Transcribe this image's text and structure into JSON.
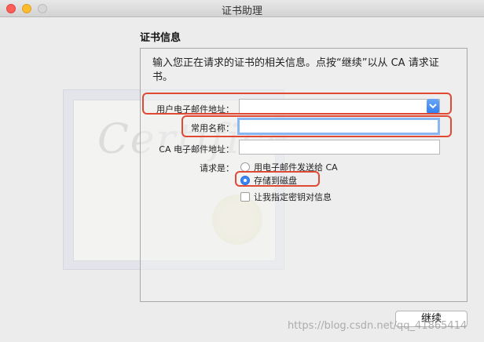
{
  "window": {
    "title": "证书助理"
  },
  "heading": "证书信息",
  "description": "输入您正在请求的证书的相关信息。点按“继续”以从 CA 请求证书。",
  "form": {
    "user_email_label": "用户电子邮件地址：",
    "user_email_value": "",
    "common_name_label": "常用名称：",
    "common_name_value": "",
    "ca_email_label": "CA 电子邮件地址：",
    "ca_email_value": "",
    "request_label": "请求是：",
    "option_email": "用电子邮件发送给 CA",
    "option_disk": "存储到磁盘",
    "option_disk_selected": true,
    "custom_key_label": "让我指定密钥对信息",
    "custom_key_checked": false
  },
  "continue_label": "继续",
  "watermark": "https://blog.csdn.net/qq_41865414",
  "cert_script": "Certifica",
  "colors": {
    "highlight": "#e04a35",
    "accent": "#3a84f3"
  }
}
